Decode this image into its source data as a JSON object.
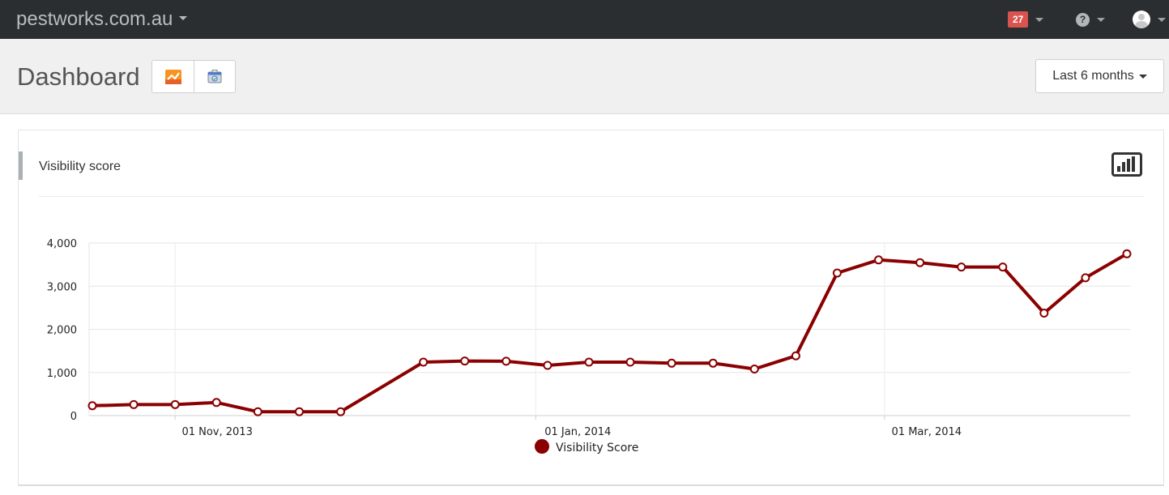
{
  "navbar": {
    "brand": "pestworks.com.au",
    "notification_count": "27",
    "help_icon": "question-circle-icon",
    "user_icon": "user-avatar-icon"
  },
  "header": {
    "title": "Dashboard",
    "view_buttons": [
      {
        "icon": "analytics-chart-icon"
      },
      {
        "icon": "webmaster-tools-icon"
      }
    ],
    "date_range": "Last 6 months"
  },
  "panel": {
    "title": "Visibility score",
    "icon": "bar-chart-icon"
  },
  "colors": {
    "navbar": "#2b2e30",
    "series": "#8b0000",
    "badge": "#d9534f"
  },
  "chart_data": {
    "type": "line",
    "title": "",
    "xlabel": "",
    "ylabel": "",
    "ylim": [
      0,
      4000
    ],
    "yticks": [
      0,
      1000,
      2000,
      3000,
      4000
    ],
    "ytick_labels": [
      "0",
      "1,000",
      "2,000",
      "3,000",
      "4,000"
    ],
    "xticks": [
      {
        "date": "2013-11-01",
        "label": "01 Nov, 2013"
      },
      {
        "date": "2014-01-01",
        "label": "01 Jan, 2014"
      },
      {
        "date": "2014-03-01",
        "label": "01 Mar, 2014"
      }
    ],
    "grid": true,
    "legend_position": "bottom",
    "series": [
      {
        "name": "Visibility Score",
        "color": "#8b0000",
        "points": [
          {
            "x": "2013-10-18",
            "y": 230
          },
          {
            "x": "2013-10-25",
            "y": 255
          },
          {
            "x": "2013-11-01",
            "y": 255
          },
          {
            "x": "2013-11-08",
            "y": 305
          },
          {
            "x": "2013-11-15",
            "y": 90
          },
          {
            "x": "2013-11-22",
            "y": 90
          },
          {
            "x": "2013-11-29",
            "y": 90
          },
          {
            "x": "2013-12-13",
            "y": 1240
          },
          {
            "x": "2013-12-20",
            "y": 1265
          },
          {
            "x": "2013-12-27",
            "y": 1260
          },
          {
            "x": "2014-01-03",
            "y": 1165
          },
          {
            "x": "2014-01-10",
            "y": 1240
          },
          {
            "x": "2014-01-17",
            "y": 1240
          },
          {
            "x": "2014-01-24",
            "y": 1215
          },
          {
            "x": "2014-01-31",
            "y": 1215
          },
          {
            "x": "2014-02-07",
            "y": 1080
          },
          {
            "x": "2014-02-14",
            "y": 1385
          },
          {
            "x": "2014-02-21",
            "y": 3305
          },
          {
            "x": "2014-02-28",
            "y": 3610
          },
          {
            "x": "2014-03-07",
            "y": 3545
          },
          {
            "x": "2014-03-14",
            "y": 3445
          },
          {
            "x": "2014-03-21",
            "y": 3445
          },
          {
            "x": "2014-03-28",
            "y": 2375
          },
          {
            "x": "2014-04-04",
            "y": 3195
          },
          {
            "x": "2014-04-11",
            "y": 3750
          }
        ]
      }
    ]
  }
}
